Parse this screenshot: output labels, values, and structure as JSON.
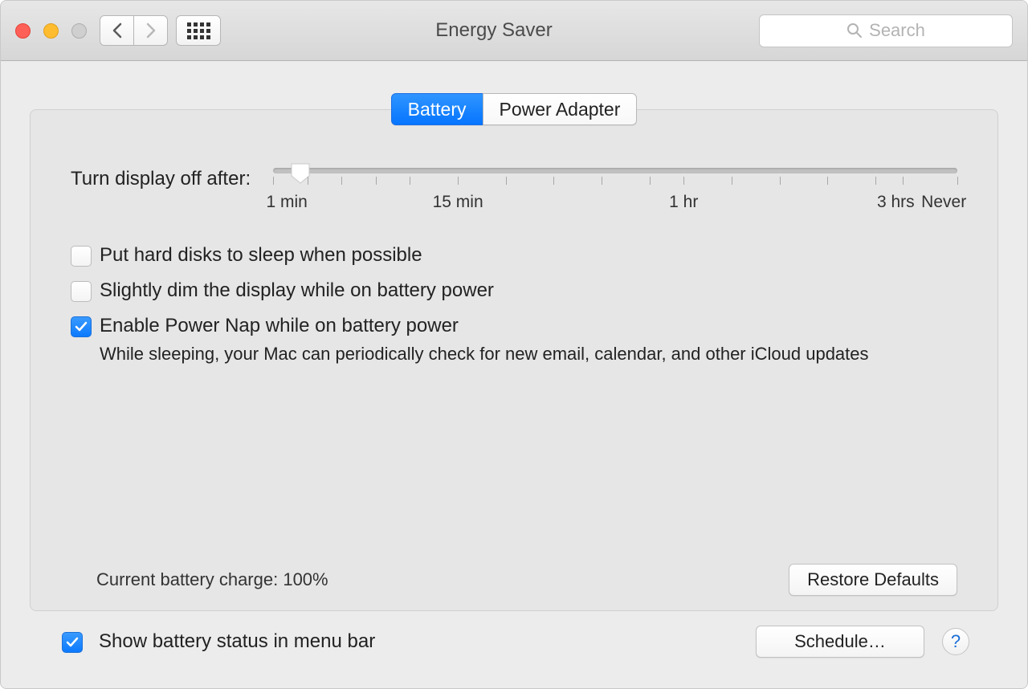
{
  "window": {
    "title": "Energy Saver",
    "search_placeholder": "Search"
  },
  "tabs": {
    "battery": "Battery",
    "power_adapter": "Power Adapter",
    "active": "battery"
  },
  "slider": {
    "label": "Turn display off after:",
    "ticks": {
      "min": "1 min",
      "fifteen": "15 min",
      "hour": "1 hr",
      "three": "3 hrs",
      "never": "Never"
    }
  },
  "checks": {
    "hard_disks": {
      "label": "Put hard disks to sleep when possible",
      "checked": false
    },
    "dim_display": {
      "label": "Slightly dim the display while on battery power",
      "checked": false
    },
    "power_nap": {
      "label": "Enable Power Nap while on battery power",
      "description": "While sleeping, your Mac can periodically check for new email, calendar, and other iCloud updates",
      "checked": true
    }
  },
  "status": "Current battery charge: 100%",
  "buttons": {
    "restore_defaults": "Restore Defaults",
    "schedule": "Schedule…"
  },
  "bottom_check": {
    "label": "Show battery status in menu bar",
    "checked": true
  },
  "help": "?"
}
